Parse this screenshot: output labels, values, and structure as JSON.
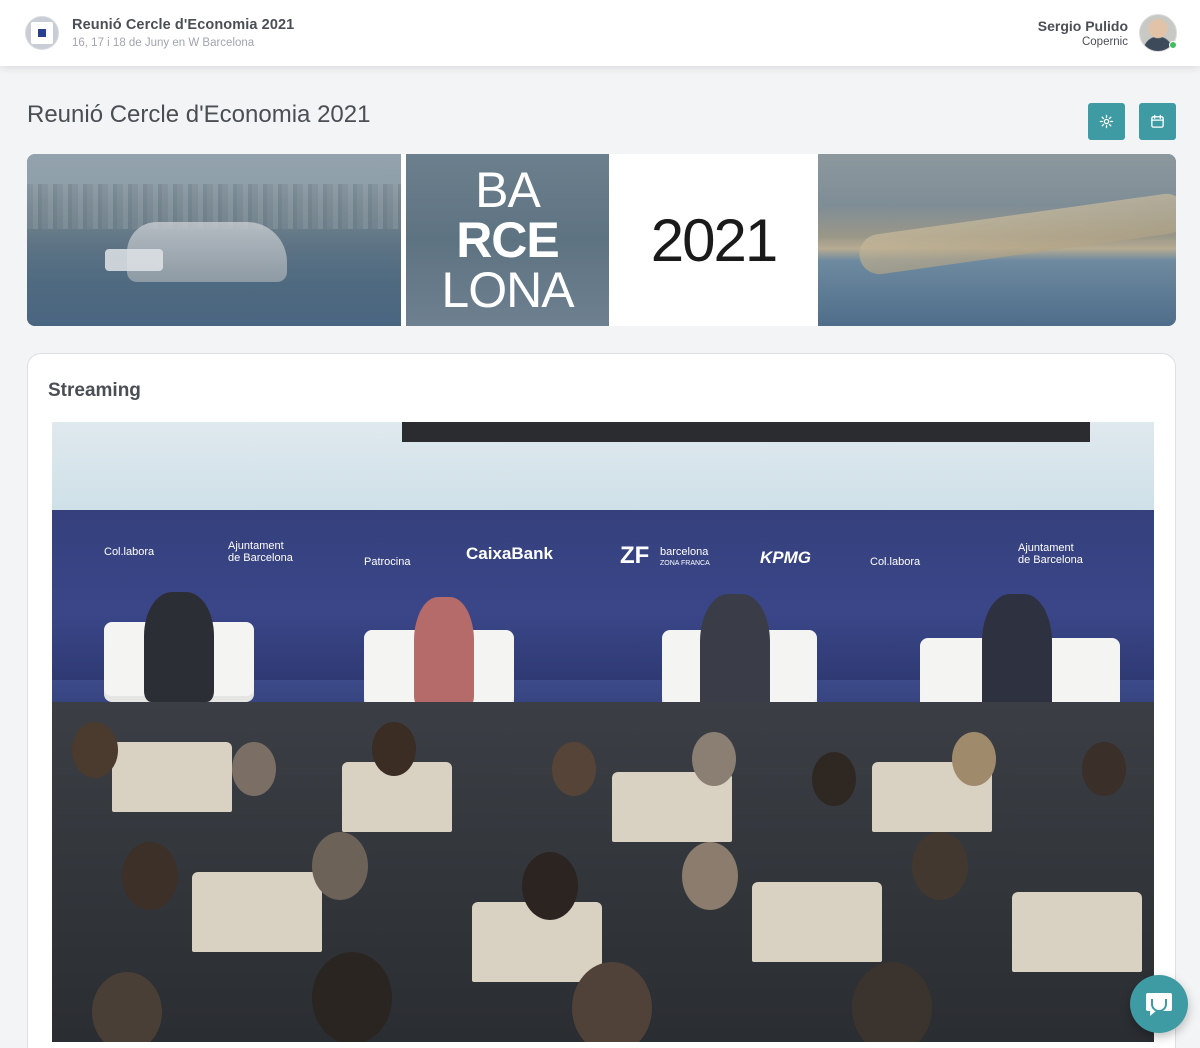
{
  "header": {
    "event_title": "Reunió Cercle d'Economia 2021",
    "event_subtitle": "16, 17 i 18 de Juny en W Barcelona",
    "user_name": "Sergio Pulido",
    "user_org": "Copernic"
  },
  "page": {
    "title": "Reunió Cercle d'Economia 2021",
    "settings_icon": "gear-icon",
    "calendar_icon": "calendar-icon"
  },
  "banner": {
    "line1": "BA",
    "line2": "RCE",
    "line3": "LONA",
    "year": "2021"
  },
  "streaming": {
    "title": "Streaming",
    "sponsors": {
      "collabora_left": "Col.labora",
      "ajuntament_left_1": "Ajuntament",
      "ajuntament_left_2": "de Barcelona",
      "patrocina": "Patrocina",
      "caixabank": "CaixaBank",
      "zf_1": "barcelona",
      "zf_2": "ZONA FRANCA",
      "zf_logo": "ZF",
      "kpmg": "KPMG",
      "collabora_right": "Col.labora",
      "ajuntament_right_1": "Ajuntament",
      "ajuntament_right_2": "de Barcelona"
    }
  },
  "colors": {
    "accent": "#3e9aa3",
    "online_status": "#3fbf5d"
  }
}
